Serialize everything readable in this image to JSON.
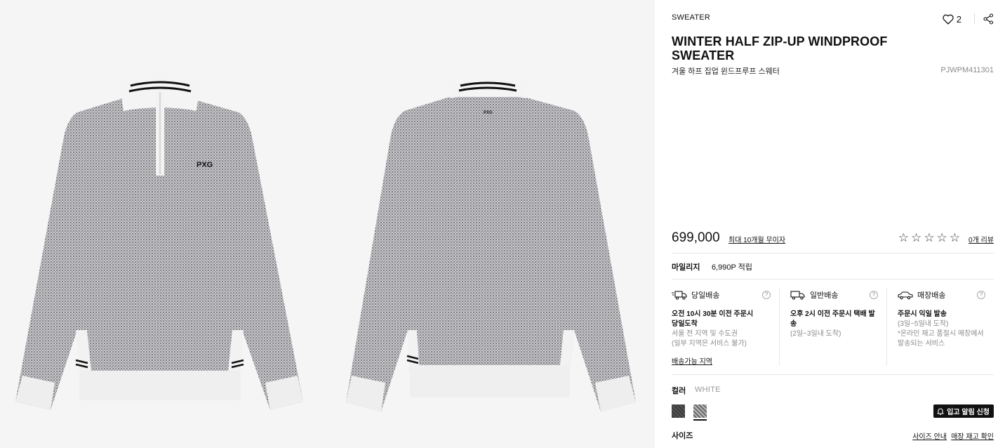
{
  "product": {
    "category": "SWEATER",
    "like_count": "2",
    "title": "WINTER HALF ZIP-UP WINDPROOF SWEATER",
    "subtitle_ko": "겨울 하프 집업 윈드프루프 스웨터",
    "sku": "PJWPM411301",
    "price": "699,000",
    "installment_link": "최대 10개월 무이자",
    "rating_stars": 0,
    "review_link": "0개 리뷰",
    "logo_text": "PXG"
  },
  "mileage": {
    "label": "마일리지",
    "value": "6,990P 적립"
  },
  "delivery": [
    {
      "icon": "truck-fast-icon",
      "name": "당일배송",
      "main_lines": [
        "오전 10시 30분 이전 주문시",
        "당일도착"
      ],
      "sub_lines": [
        "서울 전 지역 및 수도권",
        "(일부 지역은 서비스 불가)"
      ],
      "link": "배송가능 지역"
    },
    {
      "icon": "truck-icon",
      "name": "일반배송",
      "main_lines": [
        "오후 2시 이전 주문시 택배 발송"
      ],
      "sub_lines": [
        "(2일~3일내 도착)"
      ],
      "link": ""
    },
    {
      "icon": "car-icon",
      "name": "매장배송",
      "main_lines": [
        "주문시 익일 발송"
      ],
      "sub_lines": [
        "(3일~5일내 도착)",
        "*온라인 재고 품절시 매장에서",
        "발송되는 서비스"
      ],
      "link": ""
    }
  ],
  "color": {
    "label": "컬러",
    "selected": "WHITE",
    "swatches": [
      "charcoal",
      "white"
    ],
    "restock_button": "입고 알림 신청"
  },
  "size": {
    "label": "사이즈",
    "guide_link": "사이즈 안내",
    "store_stock_link": "매장 재고 확인"
  }
}
